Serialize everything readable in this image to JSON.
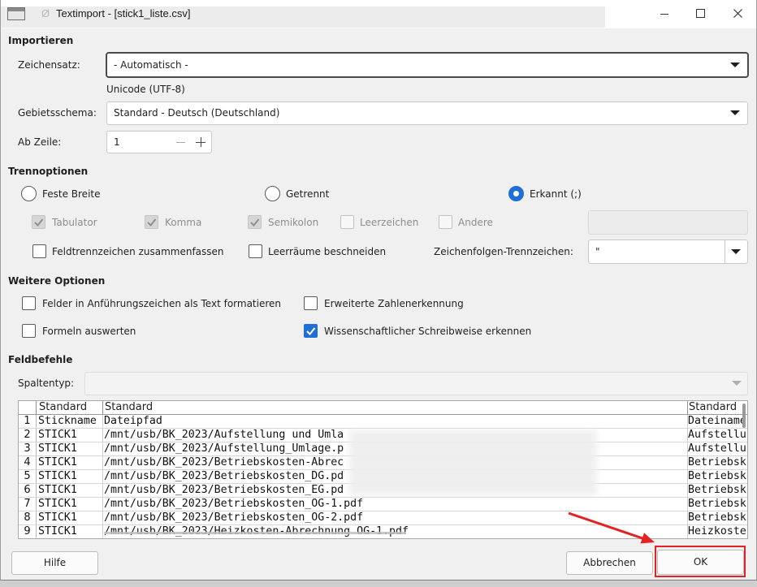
{
  "window": {
    "title_prefix": "Ø",
    "title": "Textimport - [stick1_liste.csv]"
  },
  "import": {
    "heading": "Importieren",
    "charset": {
      "label": "Zeichensatz:",
      "value": "- Automatisch -",
      "detected": "Unicode (UTF-8)"
    },
    "locale": {
      "label": "Gebietsschema:",
      "value": "Standard - Deutsch (Deutschland)"
    },
    "from_row": {
      "label": "Ab Zeile:",
      "value": "1"
    }
  },
  "separator_options": {
    "heading": "Trennoptionen",
    "fixed_width": {
      "label": "Feste Breite",
      "selected": false
    },
    "separated": {
      "label": "Getrennt",
      "selected": false
    },
    "detected": {
      "label": "Erkannt (;)",
      "selected": true
    },
    "tabulator": {
      "label": "Tabulator",
      "checked": true,
      "enabled": false
    },
    "comma": {
      "label": "Komma",
      "checked": true,
      "enabled": false
    },
    "semicolon": {
      "label": "Semikolon",
      "checked": true,
      "enabled": false
    },
    "space": {
      "label": "Leerzeichen",
      "checked": false,
      "enabled": false
    },
    "other": {
      "label": "Andere",
      "checked": false,
      "enabled": false,
      "value": ""
    },
    "merge_delimiters": {
      "label": "Feldtrennzeichen zusammenfassen",
      "checked": false,
      "enabled": true
    },
    "trim_spaces": {
      "label": "Leerräume beschneiden",
      "checked": false,
      "enabled": true
    },
    "string_delimiter": {
      "label": "Zeichenfolgen-Trennzeichen:",
      "value": "\""
    }
  },
  "other_options": {
    "heading": "Weitere Optionen",
    "quoted_as_text": {
      "label": "Felder in Anführungszeichen als Text formatieren",
      "checked": false,
      "enabled": true
    },
    "detect_special_numbers": {
      "label": "Erweiterte Zahlenerkennung",
      "checked": false,
      "enabled": true
    },
    "evaluate_formulas": {
      "label": "Formeln auswerten",
      "checked": false,
      "enabled": true
    },
    "scientific_notation": {
      "label": "Wissenschaftlicher Schreibweise erkennen",
      "checked": true,
      "enabled": true
    }
  },
  "fields": {
    "heading": "Feldbefehle",
    "column_type": {
      "label": "Spaltentyp:",
      "value": ""
    },
    "columns": [
      "Standard",
      "Standard",
      "Standard"
    ],
    "rows": [
      {
        "number": "1",
        "cells": [
          "Stickname",
          "Dateipfad",
          "Dateiname"
        ]
      },
      {
        "number": "2",
        "cells": [
          "STICK1",
          "/mnt/usb/BK_2023/Aufstellung und Umla",
          "Aufstellu"
        ]
      },
      {
        "number": "3",
        "cells": [
          "STICK1",
          "/mnt/usb/BK_2023/Aufstellung_Umlage.p",
          "Aufstellu"
        ]
      },
      {
        "number": "4",
        "cells": [
          "STICK1",
          "/mnt/usb/BK_2023/Betriebskosten-Abrec",
          "Betriebsk"
        ]
      },
      {
        "number": "5",
        "cells": [
          "STICK1",
          "/mnt/usb/BK_2023/Betriebskosten_DG.pd",
          "Betriebsk"
        ]
      },
      {
        "number": "6",
        "cells": [
          "STICK1",
          "/mnt/usb/BK_2023/Betriebskosten_EG.pd",
          "Betriebsk"
        ]
      },
      {
        "number": "7",
        "cells": [
          "STICK1",
          "/mnt/usb/BK_2023/Betriebskosten_OG-1.pdf",
          "Betriebsk"
        ]
      },
      {
        "number": "8",
        "cells": [
          "STICK1",
          "/mnt/usb/BK_2023/Betriebskosten_OG-2.pdf",
          "Betriebsk"
        ]
      },
      {
        "number": "9",
        "cells": [
          "STICK1",
          "/mnt/usb/BK_2023/Heizkosten-Abrechnung OG-1.pdf",
          "Heizkoste"
        ]
      }
    ]
  },
  "buttons": {
    "help": "Hilfe",
    "cancel": "Abbrechen",
    "ok": "OK"
  },
  "colors": {
    "accent": "#1f6fd6",
    "annotation": "#e32222"
  }
}
